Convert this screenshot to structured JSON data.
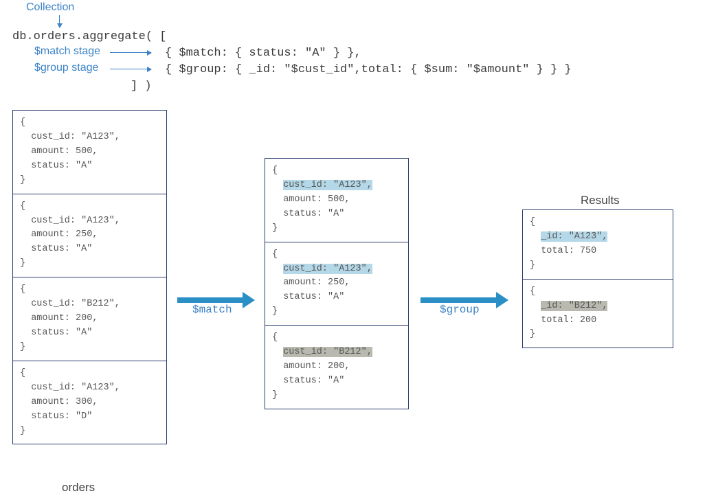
{
  "labels": {
    "collection": "Collection",
    "match_stage": "$match stage",
    "group_stage": "$group stage",
    "orders_caption": "orders",
    "results_heading": "Results",
    "match_arrow": "$match",
    "group_arrow": "$group"
  },
  "code": {
    "line1": "db.orders.aggregate( [",
    "line2": "{ $match: { status: \"A\" } },",
    "line3": "{ $group: { _id: \"$cust_id\",total: { $sum: \"$amount\" } } }",
    "line4": "] )"
  },
  "orders": [
    {
      "open": "{",
      "line1": "  cust_id: \"A123\",",
      "line2": "  amount: 500,",
      "line3": "  status: \"A\"",
      "close": "}"
    },
    {
      "open": "{",
      "line1": "  cust_id: \"A123\",",
      "line2": "  amount: 250,",
      "line3": "  status: \"A\"",
      "close": "}"
    },
    {
      "open": "{",
      "line1": "  cust_id: \"B212\",",
      "line2": "  amount: 200,",
      "line3": "  status: \"A\"",
      "close": "}"
    },
    {
      "open": "{",
      "line1": "  cust_id: \"A123\",",
      "line2": "  amount: 300,",
      "line3": "  status: \"D\"",
      "close": "}"
    }
  ],
  "matched": [
    {
      "open": "{",
      "pre": "  ",
      "hi": "cust_id: \"A123\",",
      "hicls": "hi-blue",
      "line2": "  amount: 500,",
      "line3": "  status: \"A\"",
      "close": "}"
    },
    {
      "open": "{",
      "pre": "  ",
      "hi": "cust_id: \"A123\",",
      "hicls": "hi-blue",
      "line2": "  amount: 250,",
      "line3": "  status: \"A\"",
      "close": "}"
    },
    {
      "open": "{",
      "pre": "  ",
      "hi": "cust_id: \"B212\",",
      "hicls": "hi-gray",
      "line2": "  amount: 200,",
      "line3": "  status: \"A\"",
      "close": "}"
    }
  ],
  "results": [
    {
      "open": "{",
      "pre": "  ",
      "hi": "_id: \"A123\",",
      "hicls": "hi-blue",
      "line2": "  total: 750",
      "close": "}"
    },
    {
      "open": "{",
      "pre": "  ",
      "hi": "_id: \"B212\",",
      "hicls": "hi-gray",
      "line2": "  total: 200",
      "close": "}"
    }
  ]
}
